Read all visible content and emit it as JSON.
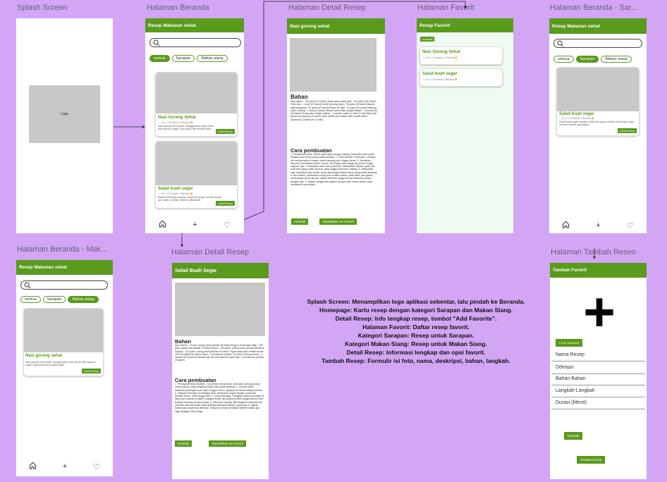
{
  "frame_titles": {
    "splash": "Splash Screen",
    "beranda": "Halaman Beranda",
    "detail1": "Halaman Detail Resep",
    "favorit": "Halaman Favorit",
    "beranda_sarapan": "Halaman Beranda - Sar...",
    "beranda_makan": "Halaman Beranda - Mak...",
    "detail2": "Halaman Detail Resep",
    "tambah": "Halaman Tambah Reseo"
  },
  "splash": {
    "logo_label": "Logo"
  },
  "beranda": {
    "appbar_title": "Resep Makanan sehat",
    "chips": [
      "semua",
      "Sarapan",
      "Makan siang"
    ],
    "cards": [
      {
        "title": "Nasi Goreng Sehat",
        "meta": "☆ 4.5 | ⏱ 20 menit | 475 kkal 🔥",
        "desc": "Nasi goreng versi sehat, menggunakan nasi merah dan sayuran segar. Kaya serat dan rendah kalori.",
        "button": "Lihat Resep"
      },
      {
        "title": "Salad buah segar",
        "meta": "☆ 4.5 | ⏱ 20 menit | 365 kkal 🔥",
        "desc": "Salad buah segar dengan campuran yogurt rendah lemak dan madu. Sumber vitamin antioksidan",
        "button": "Lihat Resep"
      }
    ]
  },
  "detail1": {
    "appbar_title": "Nasi goreng sehat",
    "bahan_title": "Bahan",
    "bahan_text": "Nasi merah - 150 gram (1/3 kalori) Dada ayam tanpa kulit - 100 gram (160 kalori) Putih telur - 1 butir (17 kalori) Wortel (potong dadu) - 50 gram (20 kalori) Bayam atau kangkung - 30 gram (10 kalori) Buncis iris tipis - 20 gram (10 kalori) Bawang putih, cincang - 1 siung (4 kalori) Minyak zaitun atau minyak kelapa - 1 sendok teh (40 kalori) Kecap asin rendah sodium - 1 sendok makan (4 kalori) Lada hitam dan garam secukupnya (0 kalori) Cabe merah atau bubuk cabe sesuai selera (opsional) (2 kalori per 1 buah)",
    "cara_title": "Cara pembuatan",
    "cara_text": "1. Persiapkan bahan: Rebus dada ayam hingga matang, kemudian suwir-suwir. Siapkan nasi merah yang sudah dimasak. 2. Tumis Bumbu: Panaskan 1 sendok teh minyak zaitun di wajan, tumis bawang putih hingga harum. 3. Masukkan Sayuran: Tambahkan wortel, buncis, dan bayam atau kangkung, tumis hingga sayuran layu. 4. Masukkan ayam dan putih telur: Tambahkan suwiran ayam dan putih telur yang sudah dikocok, aduk hingga putih telur matang. 5. Tambahkan nasi: Masukkan nasi merah, aduk rata dengan bahan-bahan yang sudah dimasak. 6. Beri bumbu: Tambahkan kecap asin rendah sodium, lada hitam, dan garam secukupnya. Aduk rata dan masak sebentar hingga semua bahan tercampur dengan baik. 7. Sajikan: Angkat dan sajikan dengan cabe sesuai selera untuk menambah rasa pedas.",
    "btn_back": "Kembali",
    "btn_fav": "Tambahkan Ke Favorit"
  },
  "favorit": {
    "appbar_title": "Resep Favorit",
    "btn_back": "Kembali",
    "items": [
      {
        "title": "Nasi Goreng Sehat",
        "meta": "☆ 4.5 | ⏱ 20 menit | 475 kkal 🔥"
      },
      {
        "title": "Salad buah segar",
        "meta": "☆ 4.5 | ⏱ 20 menit | 365 kkal 🔥"
      }
    ]
  },
  "beranda_sarapan": {
    "appbar_title": "Resep Makanan sehat",
    "chips": [
      "semua",
      "Sarapan",
      "Makan siang"
    ],
    "card": {
      "title": "Salad buah segar",
      "meta": "☆ 4.5 | ⏱ 20 menit | 365 kkal 🔥",
      "desc": "Salad buah segar dengan campuran yogurt rendah lemak dan madu. Sumber vitamin antioksidan",
      "button": "Lihat Resep"
    }
  },
  "beranda_makan": {
    "appbar_title": "Resep Makanan sehat",
    "chips": [
      "semua",
      "Sarapan",
      "Makan siang"
    ],
    "card": {
      "title": "Nasi goreng sehat",
      "desc": "Nasi goreng versi sehat, menggunakan nasi merah dan sayuran segar. Kaya serat dan rendah kalori.",
      "button": "Lihat Resep"
    }
  },
  "detail2": {
    "appbar_title": "Salad Buah Segar",
    "bahan_title": "Bahan",
    "bahan_text": "Apel merah - 1 buah, potong dadu (sekitar 80 kalori) Anggur merah atau hijau - 100 gram, belah dua (sekitar 70 kalori) Melon - 100 gram, potong dadu (sekitar 35 kalori) Pepaya - 100 gram, potong dadu (sekitar 45 kalori) Yogurt tawar atau rendah lemak - 100 ml (sekitar 60 kalori) Madu - 1 sendok teh (sekitar 20 kalori) Perasan lemon - 1 sendok teh (5 kalori) Taburan biji chia atau almond (opsional) - 1 sendok teh (sekitar 30 kalori)",
    "cara_title": "Cara pembuatan",
    "cara_text": "1. Persiapkan Buah-Buahan: Cuci bersih semua buah, kemudian potong-potong sesuai ukuran yang diinginkan (dadu atau irisan sedang). 2. Campur Buah: Masukkan potongan buah (apel, anggur, melon, pepaya) ke dalam mangkuk besar. 3. Siapkan Dressing: Di mangkuk kecil, campurkan yogurt dengan madu dan perasan lemon. Aduk hingga rata. 4. Tuang Dressing: Tuangkan campuran yogurt ke atas buah-buahan di dalam mangkuk besar, lalu aduk perlahan hingga semua buah terlapisi dressing secara merata. 5. Taburkan Topping: Jika diinginkan taburkan biji chia atau almond di atas salad sebagai tambahan tekstur (opsional). 6. Sajikan: Salad buah segar siap dinikmati. Simpan di lemari pendingin terlebih dahulu jika ingin disajikan lebih dingin.",
    "btn_back": "Kembali",
    "btn_fav": "Tambahkan Ke Favorit"
  },
  "tambah": {
    "appbar_title": "Tambah Favorit",
    "plus": "+",
    "btn_pick": "PILIH GAMBAR",
    "fields": [
      "Nama Resep",
      "Dekripsi",
      "Bahan Bahan",
      "Langkah Langkah",
      "Durasi (Menit)"
    ],
    "btn_back": "Kembali",
    "btn_submit": "Tambah Resep"
  },
  "description": [
    "Splash Screen: Menampilkan logo aplikasi sebentar, lalu pindah ke Beranda.",
    "Homepage: Kartu resep dengan kategori Sarapan dan Makan Siang.",
    "Detail Resep: Info lengkap resep, tombol \"Add Favorite\".",
    "Halaman Favorit: Daftar resep favorit.",
    "Kategori Sarapan: Resep untuk Sarapan.",
    "Kategori Makan Siang: Resep untuk Makan Siang.",
    "Detail Resep: Informasi lengkap dan opsi favorit.",
    "Tambah Resep: Formulir isi foto, nama, deskripsi, bahan, langkah."
  ],
  "colors": {
    "canvas": "#d3a6f5",
    "accent": "#5a9a1c",
    "placeholder": "#c8c8c8",
    "favorit_bg": "#effaf0"
  }
}
